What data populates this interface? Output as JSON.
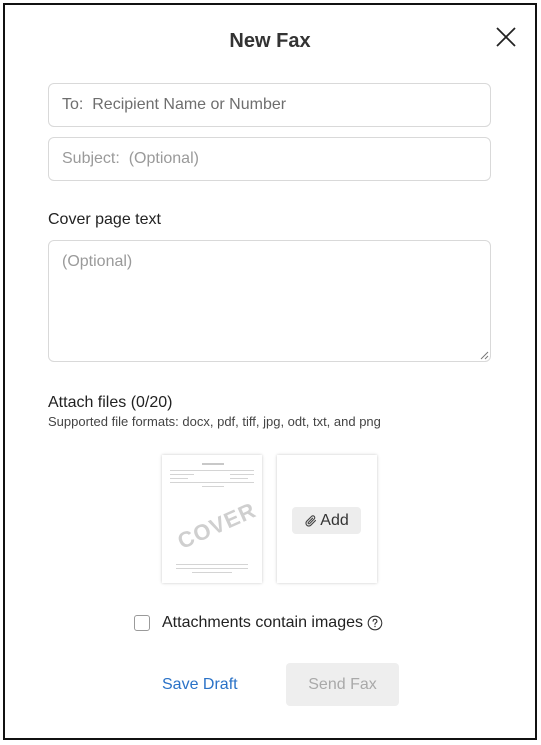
{
  "dialog": {
    "title": "New Fax",
    "close_icon": "close-icon"
  },
  "to_field": {
    "value": "",
    "placeholder": "To:  Recipient Name or Number"
  },
  "subject_field": {
    "value": "",
    "placeholder": "Subject:  (Optional)"
  },
  "cover_page": {
    "label": "Cover page text",
    "value": "",
    "placeholder": "(Optional)"
  },
  "attachments": {
    "label": "Attach files (0/20)",
    "formats": "Supported file formats: docx, pdf, tiff, jpg, odt, txt, and png",
    "cover_thumbnail_text": "COVER",
    "add_label": "Add",
    "add_icon": "paperclip-icon"
  },
  "images_option": {
    "label": "Attachments contain images",
    "checked": false,
    "help_icon": "help-icon"
  },
  "actions": {
    "save_draft": "Save Draft",
    "send_fax": "Send Fax",
    "send_enabled": false
  }
}
